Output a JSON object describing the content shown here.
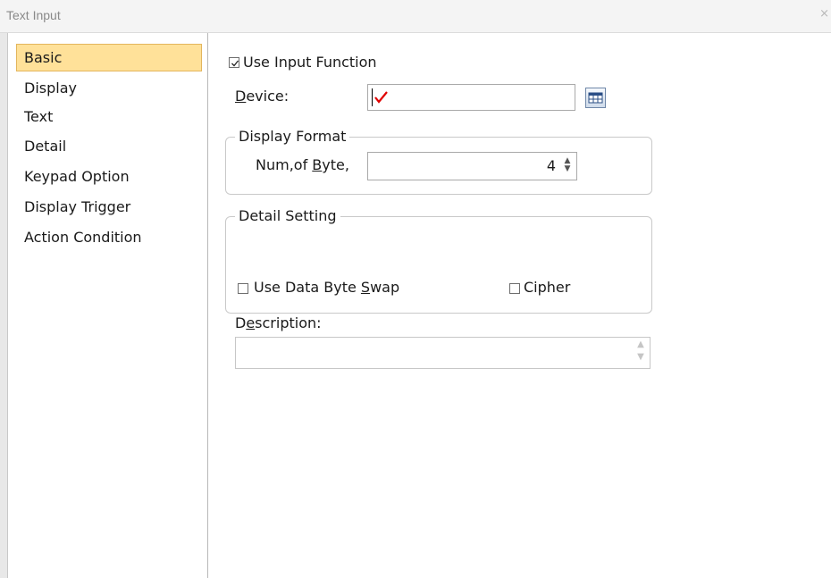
{
  "window": {
    "title": "Text Input",
    "close_glyph": "×"
  },
  "sidebar": {
    "items": [
      {
        "label": "Basic",
        "active": true
      },
      {
        "label": "Display"
      },
      {
        "label": "Text"
      },
      {
        "label": "Detail"
      },
      {
        "label": "Keypad Option"
      },
      {
        "label": "Display Trigger"
      },
      {
        "label": "Action Condition"
      }
    ]
  },
  "basic": {
    "use_input_function": {
      "label": "Use Input Function",
      "checked": true
    },
    "device": {
      "label_prefix": "D",
      "label_rest": "evice:",
      "value": "",
      "marker_color": "#e00000"
    },
    "display_format": {
      "legend": "Display Format",
      "num_of_byte": {
        "label_prefix": "Num,of ",
        "label_key": "B",
        "label_rest": "yte,",
        "value": "4"
      }
    },
    "detail_setting": {
      "legend": "Detail Setting",
      "use_data_byte_swap": {
        "label_prefix": "Use Data Byte ",
        "label_key": "S",
        "label_rest": "wap",
        "checked": false
      },
      "cipher": {
        "label": "Cipher",
        "checked": false
      }
    },
    "description": {
      "label_prefix": "D",
      "label_key": "e",
      "label_rest": "scription:",
      "value": ""
    }
  },
  "icons": {
    "device_browse": "table-grid-icon",
    "spin_up": "▲",
    "spin_down": "▼"
  }
}
